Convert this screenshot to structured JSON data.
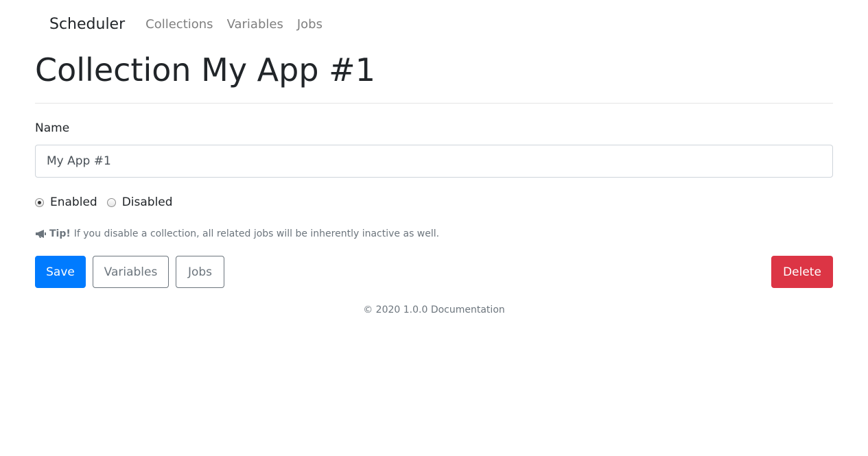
{
  "navbar": {
    "brand": "Scheduler",
    "links": [
      "Collections",
      "Variables",
      "Jobs"
    ]
  },
  "title": "Collection My App #1",
  "form": {
    "name_label": "Name",
    "name_value": "My App #1",
    "status_options": [
      {
        "label": "Enabled",
        "checked": true
      },
      {
        "label": "Disabled",
        "checked": false
      }
    ],
    "tip_strong": "Tip!",
    "tip_text": "If you disable a collection, all related jobs will be inherently inactive as well."
  },
  "buttons": {
    "save": "Save",
    "variables": "Variables",
    "jobs": "Jobs",
    "delete": "Delete"
  },
  "footer": {
    "copyright": "© 2020 1.0.0",
    "documentation_link": "Documentation"
  },
  "colors": {
    "primary": "#007bff",
    "danger": "#dc3545",
    "secondary": "#6c757d"
  },
  "icons": {
    "tip": "megaphone-icon"
  }
}
